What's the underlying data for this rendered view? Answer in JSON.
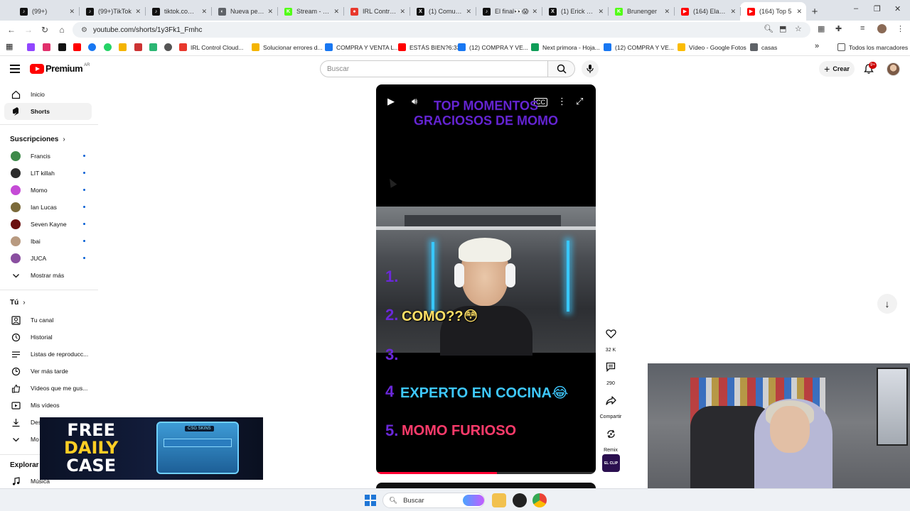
{
  "browser": {
    "tabs": [
      {
        "label": "(99+)",
        "color": "#111111",
        "glyph": "♪"
      },
      {
        "label": "(99+)TikTok",
        "color": "#111111",
        "glyph": "♪"
      },
      {
        "label": "tiktok.com/@",
        "color": "#111111",
        "glyph": "♪"
      },
      {
        "label": "Nueva pesta",
        "color": "#5f6368",
        "glyph": "◐"
      },
      {
        "label": "Stream - Kic",
        "color": "#53fc18",
        "glyph": "K"
      },
      {
        "label": "IRL Control C",
        "color": "#e8382d",
        "glyph": "●"
      },
      {
        "label": "(1) Comunic",
        "color": "#111111",
        "glyph": "X"
      },
      {
        "label": "El final👀😱",
        "color": "#111111",
        "glyph": "♪"
      },
      {
        "label": "(1) Erick Buk",
        "color": "#111111",
        "glyph": "X"
      },
      {
        "label": "Brunenger",
        "color": "#53fc18",
        "glyph": "K"
      },
      {
        "label": "(164) Eladio",
        "color": "#ff0000",
        "glyph": "▶"
      },
      {
        "label": "(164) Top 5",
        "color": "#ff0000",
        "glyph": "▶",
        "active": true
      }
    ],
    "url": "youtube.com/shorts/1y3Fk1_Fmhc",
    "bookmarks": [
      {
        "label": "IRL Control Cloud...",
        "color": "#e8382d"
      },
      {
        "label": "Solucionar errores d...",
        "color": "#f4b400"
      },
      {
        "label": "COMPRA Y VENTA L...",
        "color": "#1877f2"
      },
      {
        "label": "ESTÁS BIEN?6:33",
        "color": "#ff0000"
      },
      {
        "label": "(12) COMPRA Y VE...",
        "color": "#1877f2"
      },
      {
        "label": "Next primora - Hoja...",
        "color": "#0f9d58"
      },
      {
        "label": "(12) COMPRA Y VE...",
        "color": "#1877f2"
      },
      {
        "label": "Vídeo - Google Fotos",
        "color": "#fbbc04"
      },
      {
        "label": "casas",
        "color": "#5f6368"
      }
    ],
    "all_bookmarks": "Todos los marcadores"
  },
  "youtube": {
    "logo_text": "Premium",
    "logo_region": "AR",
    "search_placeholder": "Buscar",
    "create_label": "Crear",
    "notif_count": "9+",
    "sidebar": {
      "main": [
        {
          "label": "Inicio",
          "icon": "home-icon"
        },
        {
          "label": "Shorts",
          "icon": "shorts-icon",
          "active": true
        }
      ],
      "subs_title": "Suscripciones",
      "subs": [
        {
          "label": "Francis",
          "color": "#3e8a4a"
        },
        {
          "label": "LIT killah",
          "color": "#2d2d2d"
        },
        {
          "label": "Momo",
          "color": "#c54bd6"
        },
        {
          "label": "Ian Lucas",
          "color": "#7b6a3a"
        },
        {
          "label": "Seven Kayne",
          "color": "#6b1010"
        },
        {
          "label": "Ibai",
          "color": "#b89a80"
        },
        {
          "label": "JUCA",
          "color": "#8a4fa0"
        }
      ],
      "show_more": "Mostrar más",
      "you_title": "Tú",
      "you": [
        {
          "label": "Tu canal",
          "icon": "channel-icon"
        },
        {
          "label": "Historial",
          "icon": "history-icon"
        },
        {
          "label": "Listas de reproducc...",
          "icon": "playlist-icon"
        },
        {
          "label": "Ver más tarde",
          "icon": "clock-icon"
        },
        {
          "label": "Vídeos que me gus...",
          "icon": "like-icon"
        },
        {
          "label": "Mis vídeos",
          "icon": "video-icon"
        },
        {
          "label": "Des",
          "icon": "download-icon"
        },
        {
          "label": "Mo",
          "icon": "chevron-down-icon"
        }
      ],
      "explore_title": "Explorar",
      "explore": [
        {
          "label": "Música",
          "icon": "music-icon"
        }
      ]
    },
    "short": {
      "title_line1": "TOP MOMENTOS",
      "title_line2": "GRACIOSOS DE MOMO",
      "items": [
        {
          "num": "1.",
          "text": ""
        },
        {
          "num": "2.",
          "text": "COMO??😳",
          "color": "#ffe066"
        },
        {
          "num": "3.",
          "text": ""
        },
        {
          "num": "4",
          "text": "EXPERTO EN COCINA😂",
          "color": "#3ec8ff"
        },
        {
          "num": "5.",
          "text": "MOMO FURIOSO",
          "color": "#ff3b6b"
        }
      ],
      "progress": 0.55,
      "actions": {
        "likes": "32 K",
        "comments": "290",
        "share": "Compartir",
        "remix": "Remix"
      },
      "channel_label": "EL CLIP"
    }
  },
  "overlays": {
    "ad_line1": "FREE",
    "ad_line2": "DAILY",
    "ad_line3": "CASE",
    "ad_tag": "CSG SKINS"
  },
  "taskbar": {
    "search": "Buscar"
  }
}
